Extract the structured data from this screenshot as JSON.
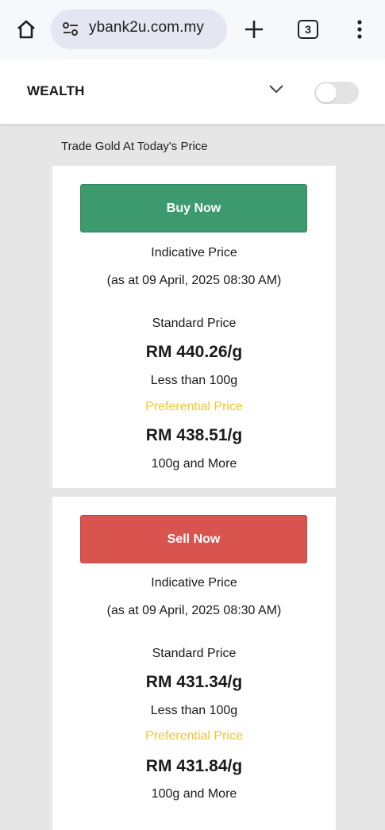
{
  "browser": {
    "url": "ybank2u.com.my",
    "tab_count": "3"
  },
  "header": {
    "title": "WEALTH",
    "toggle_on": false
  },
  "section": {
    "title": "Trade Gold At Today's Price"
  },
  "buy": {
    "button_label": "Buy Now",
    "indicative_label": "Indicative Price",
    "as_at": "(as at 09 April, 2025 08:30 AM)",
    "standard_label": "Standard Price",
    "standard_price": "RM 440.26/g",
    "standard_qty": "Less than 100g",
    "preferential_label": "Preferential Price",
    "preferential_price": "RM 438.51/g",
    "preferential_qty": "100g and More"
  },
  "sell": {
    "button_label": "Sell Now",
    "indicative_label": "Indicative Price",
    "as_at": "(as at 09 April, 2025 08:30 AM)",
    "standard_label": "Standard Price",
    "standard_price": "RM 431.34/g",
    "standard_qty": "Less than 100g",
    "preferential_label": "Preferential Price",
    "preferential_price": "RM 431.84/g",
    "preferential_qty": "100g and More"
  },
  "colors": {
    "buy": "#3d9a6e",
    "sell": "#d9534f",
    "preferential": "#f2c530"
  }
}
